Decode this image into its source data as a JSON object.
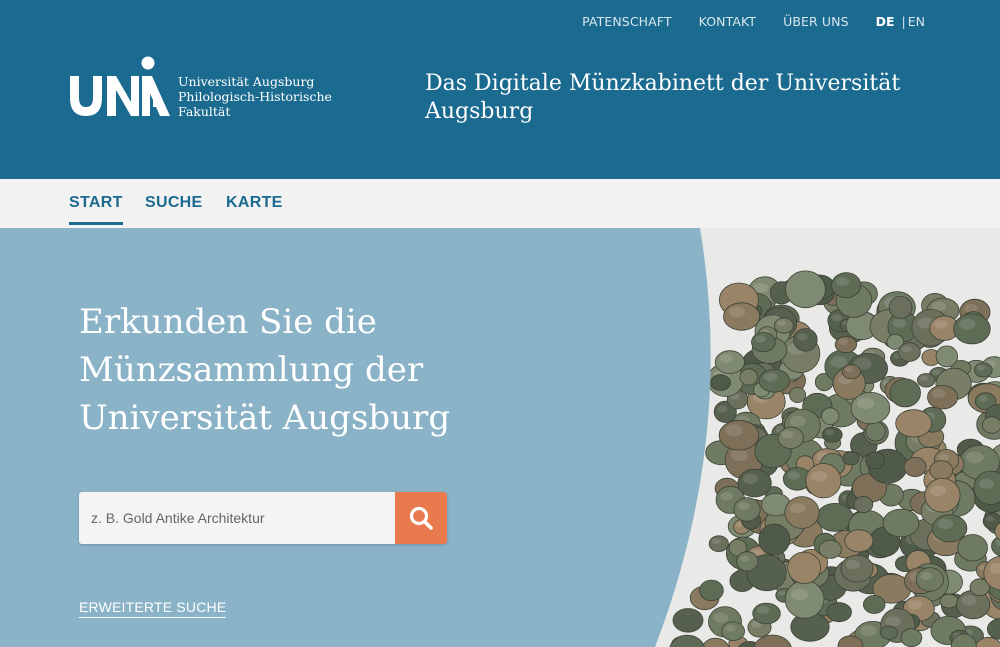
{
  "topnav": {
    "items": [
      "PATENSCHAFT",
      "KONTAKT",
      "ÜBER UNS"
    ],
    "lang_active": "DE",
    "lang_separator": "|",
    "lang_other": "EN"
  },
  "logo": {
    "lines": [
      "Universität Augsburg",
      "Philologisch-Historische",
      "Fakultät"
    ]
  },
  "header": {
    "title": "Das Digitale Münzkabinett der Universität Augsburg"
  },
  "mainnav": {
    "items": [
      {
        "label": "START",
        "active": true
      },
      {
        "label": "SUCHE",
        "active": false
      },
      {
        "label": "KARTE",
        "active": false
      }
    ]
  },
  "hero": {
    "heading": "Erkunden Sie die Münzsammlung der Universität Augsburg",
    "search_placeholder": "z. B. Gold Antike Architektur",
    "advanced_search_label": "ERWEITERTE SUCHE"
  },
  "colors": {
    "header_bg": "#1b6a90",
    "nav_bg": "#f2f2f2",
    "hero_bg": "#8bb3c7",
    "search_button": "#e87a4e",
    "coin_photo_bg": "#e9e9e7"
  },
  "icons": {
    "search_button": "search-icon"
  }
}
